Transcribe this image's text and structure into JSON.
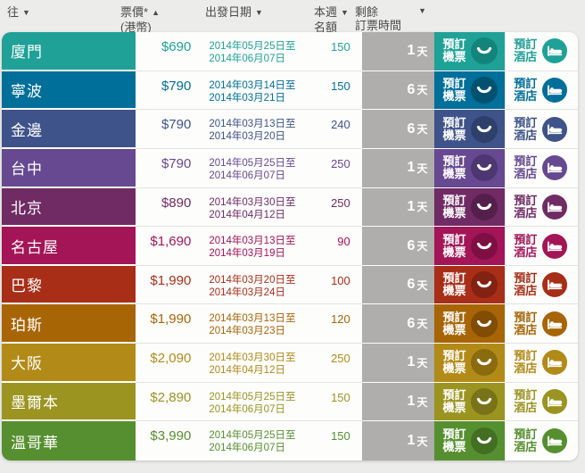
{
  "header": {
    "col_destination": "往",
    "col_price_line1": "票價*",
    "col_price_line2": "(港幣)",
    "col_date": "出發日期",
    "col_week_line1": "本週",
    "col_week_line2": "名額",
    "col_remaining_line1": "剩餘",
    "col_remaining_line2": "訂票時間",
    "sort_desc_icon": "▼",
    "sort_asc_icon": "▲"
  },
  "buttons": {
    "book_flight_line1": "預訂",
    "book_flight_line2": "機票",
    "book_hotel_line1": "預訂",
    "book_hotel_line2": "酒店"
  },
  "day_unit": "天",
  "colors": {
    "page_background": "#ecedeb",
    "card_background": "#fdfdfc",
    "days_bar_gray": "#afaeac",
    "header_text": "#4b4b49"
  },
  "rows": [
    {
      "destination": "廈門",
      "price": "$690",
      "date_from": "2014年05月25日至",
      "date_to": "2014年06月07日",
      "quota": "150",
      "days_left": "1",
      "color": "#1FA197",
      "color_dark": "#14847B"
    },
    {
      "destination": "寧波",
      "price": "$790",
      "date_from": "2014年03月14日至",
      "date_to": "2014年03月21日",
      "quota": "150",
      "days_left": "6",
      "color": "#006F99",
      "color_dark": "#00526F"
    },
    {
      "destination": "金邊",
      "price": "$790",
      "date_from": "2014年03月13日至",
      "date_to": "2014年03月20日",
      "quota": "240",
      "days_left": "6",
      "color": "#3E5389",
      "color_dark": "#2E3F6B"
    },
    {
      "destination": "台中",
      "price": "$790",
      "date_from": "2014年05月25日至",
      "date_to": "2014年06月07日",
      "quota": "250",
      "days_left": "1",
      "color": "#664990",
      "color_dark": "#4E3671"
    },
    {
      "destination": "北京",
      "price": "$890",
      "date_from": "2014年03月30日至",
      "date_to": "2014年04月12日",
      "quota": "250",
      "days_left": "1",
      "color": "#702B64",
      "color_dark": "#541F4B"
    },
    {
      "destination": "名古屋",
      "price": "$1,690",
      "date_from": "2014年03月13日至",
      "date_to": "2014年03月19日",
      "quota": "90",
      "days_left": "6",
      "color": "#A31557",
      "color_dark": "#7E0F42"
    },
    {
      "destination": "巴黎",
      "price": "$1,990",
      "date_from": "2014年03月20日至",
      "date_to": "2014年03月24日",
      "quota": "100",
      "days_left": "6",
      "color": "#A82E18",
      "color_dark": "#832112"
    },
    {
      "destination": "珀斯",
      "price": "$1,990",
      "date_from": "2014年03月13日至",
      "date_to": "2014年03月23日",
      "quota": "120",
      "days_left": "6",
      "color": "#A76506",
      "color_dark": "#814D04"
    },
    {
      "destination": "大阪",
      "price": "$2,090",
      "date_from": "2014年03月30日至",
      "date_to": "2014年04月12日",
      "quota": "250",
      "days_left": "1",
      "color": "#B28A17",
      "color_dark": "#8B6B10"
    },
    {
      "destination": "墨爾本",
      "price": "$2,890",
      "date_from": "2014年05月25日至",
      "date_to": "2014年06月07日",
      "quota": "150",
      "days_left": "1",
      "color": "#9B9421",
      "color_dark": "#787218"
    },
    {
      "destination": "溫哥華",
      "price": "$3,990",
      "date_from": "2014年05月25日至",
      "date_to": "2014年06月07日",
      "quota": "150",
      "days_left": "1",
      "color": "#568F2F",
      "color_dark": "#426F22"
    }
  ]
}
